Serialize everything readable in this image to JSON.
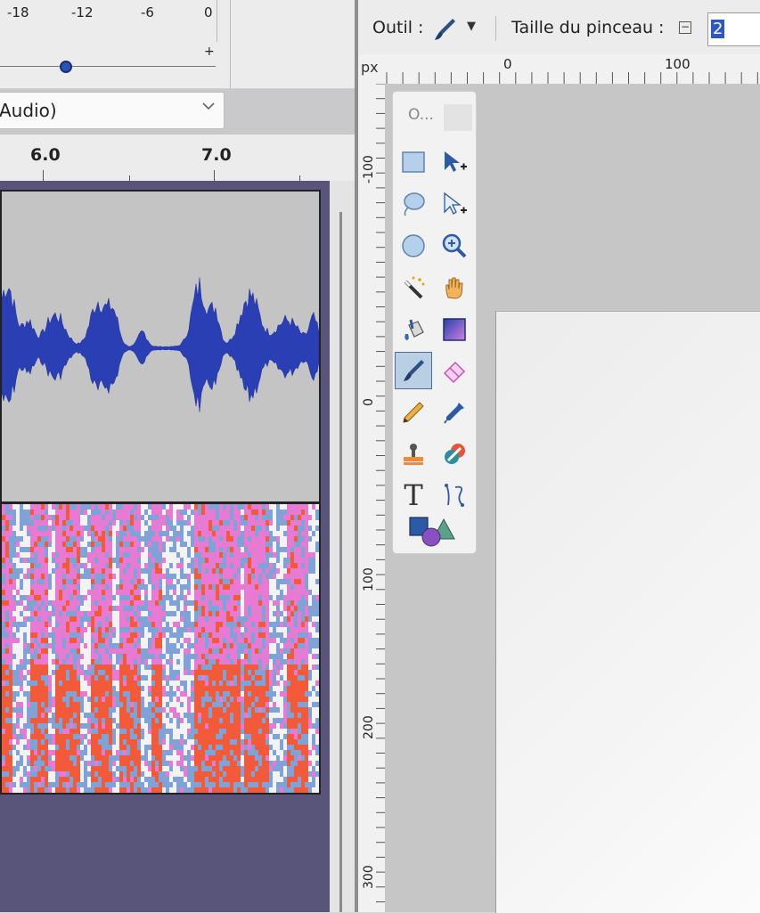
{
  "audacity": {
    "meter_labels": [
      "-18",
      "-12",
      "-6",
      "0"
    ],
    "slider_plus": "+",
    "gain_slider_level": 0.3,
    "device_text": "Audio)",
    "device_chevron_icon": "chevron-down-icon",
    "timeline_labels": [
      "6.0",
      "7.0"
    ],
    "waveform_color": "#2a3fb3",
    "spectrogram_colors": [
      "#7fa3d6",
      "#e77bd4",
      "#f25a3a",
      "#f3f3f3"
    ]
  },
  "gimp": {
    "outil_label": "Outil :",
    "brush_icon": "paintbrush-icon",
    "dropdown_icon": "caret-down-icon",
    "taille_label": "Taille du pinceau :",
    "minus_icon": "minus-box-icon",
    "brush_size": "2",
    "ruler_unit": "px",
    "hruler_labels": [
      "0",
      "100"
    ],
    "vruler_labels": [
      "-100",
      "0",
      "100",
      "200",
      "300"
    ],
    "toolbox_title": "O...",
    "selected_tool": "paintbrush",
    "tools": [
      {
        "name": "rect-select-icon"
      },
      {
        "name": "move-tool-icon"
      },
      {
        "name": "free-select-icon"
      },
      {
        "name": "align-tool-icon"
      },
      {
        "name": "ellipse-select-icon"
      },
      {
        "name": "zoom-icon"
      },
      {
        "name": "fuzzy-select-icon"
      },
      {
        "name": "hand-pan-icon"
      },
      {
        "name": "bucket-fill-icon"
      },
      {
        "name": "gradient-icon"
      },
      {
        "name": "paintbrush-icon"
      },
      {
        "name": "eraser-icon"
      },
      {
        "name": "pencil-icon"
      },
      {
        "name": "color-picker-icon"
      },
      {
        "name": "clone-stamp-icon"
      },
      {
        "name": "heal-icon"
      },
      {
        "name": "text-tool-icon"
      },
      {
        "name": "paths-tool-icon"
      },
      {
        "name": "fg-bg-colors-icon"
      }
    ],
    "text_tool_glyph": "T"
  }
}
